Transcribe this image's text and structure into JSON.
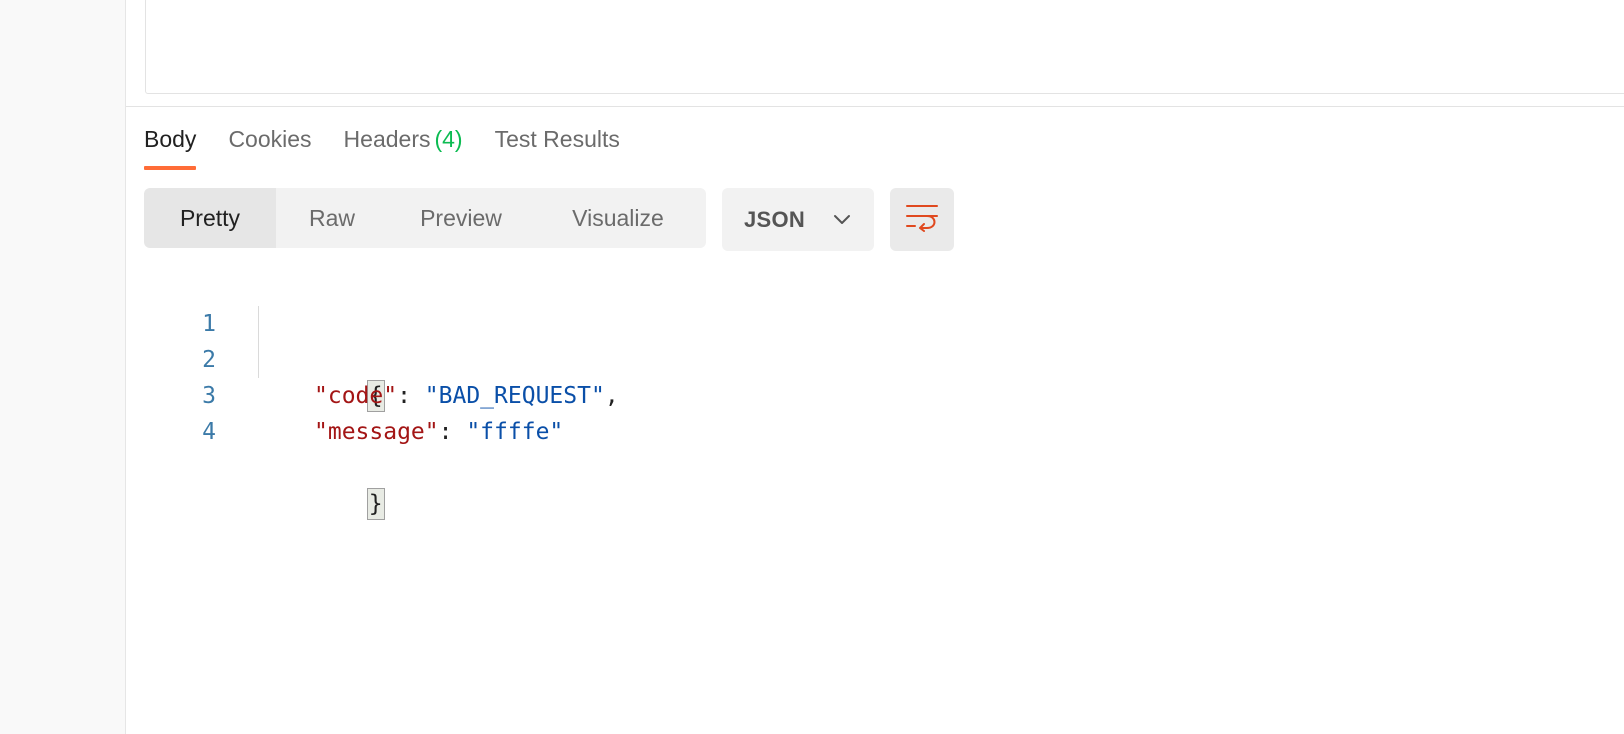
{
  "response": {
    "tabs": [
      {
        "label": "Body",
        "count": ""
      },
      {
        "label": "Cookies",
        "count": ""
      },
      {
        "label": "Headers",
        "count": "(4)"
      },
      {
        "label": "Test Results",
        "count": ""
      }
    ],
    "active_tab": "Body",
    "view_modes": [
      "Pretty",
      "Raw",
      "Preview",
      "Visualize"
    ],
    "active_view_mode": "Pretty",
    "format": "JSON",
    "wrap_icon": "wrap-lines-icon",
    "format_icon": "chevron-down-icon"
  },
  "editor": {
    "lines": [
      {
        "number": "1",
        "open": "{"
      },
      {
        "number": "2",
        "key": "\"code\"",
        "sep": ": ",
        "value": "\"BAD_REQUEST\"",
        "trail": ","
      },
      {
        "number": "3",
        "key": "\"message\"",
        "sep": ": ",
        "value": "\"ffffe\"",
        "trail": ""
      },
      {
        "number": "4",
        "close": "}"
      }
    ]
  },
  "colors": {
    "accent": "#ff6c37",
    "count_green": "#0cbb52",
    "json_key": "#a31515",
    "json_string": "#0a4fa8",
    "line_number": "#3b7aa8"
  }
}
